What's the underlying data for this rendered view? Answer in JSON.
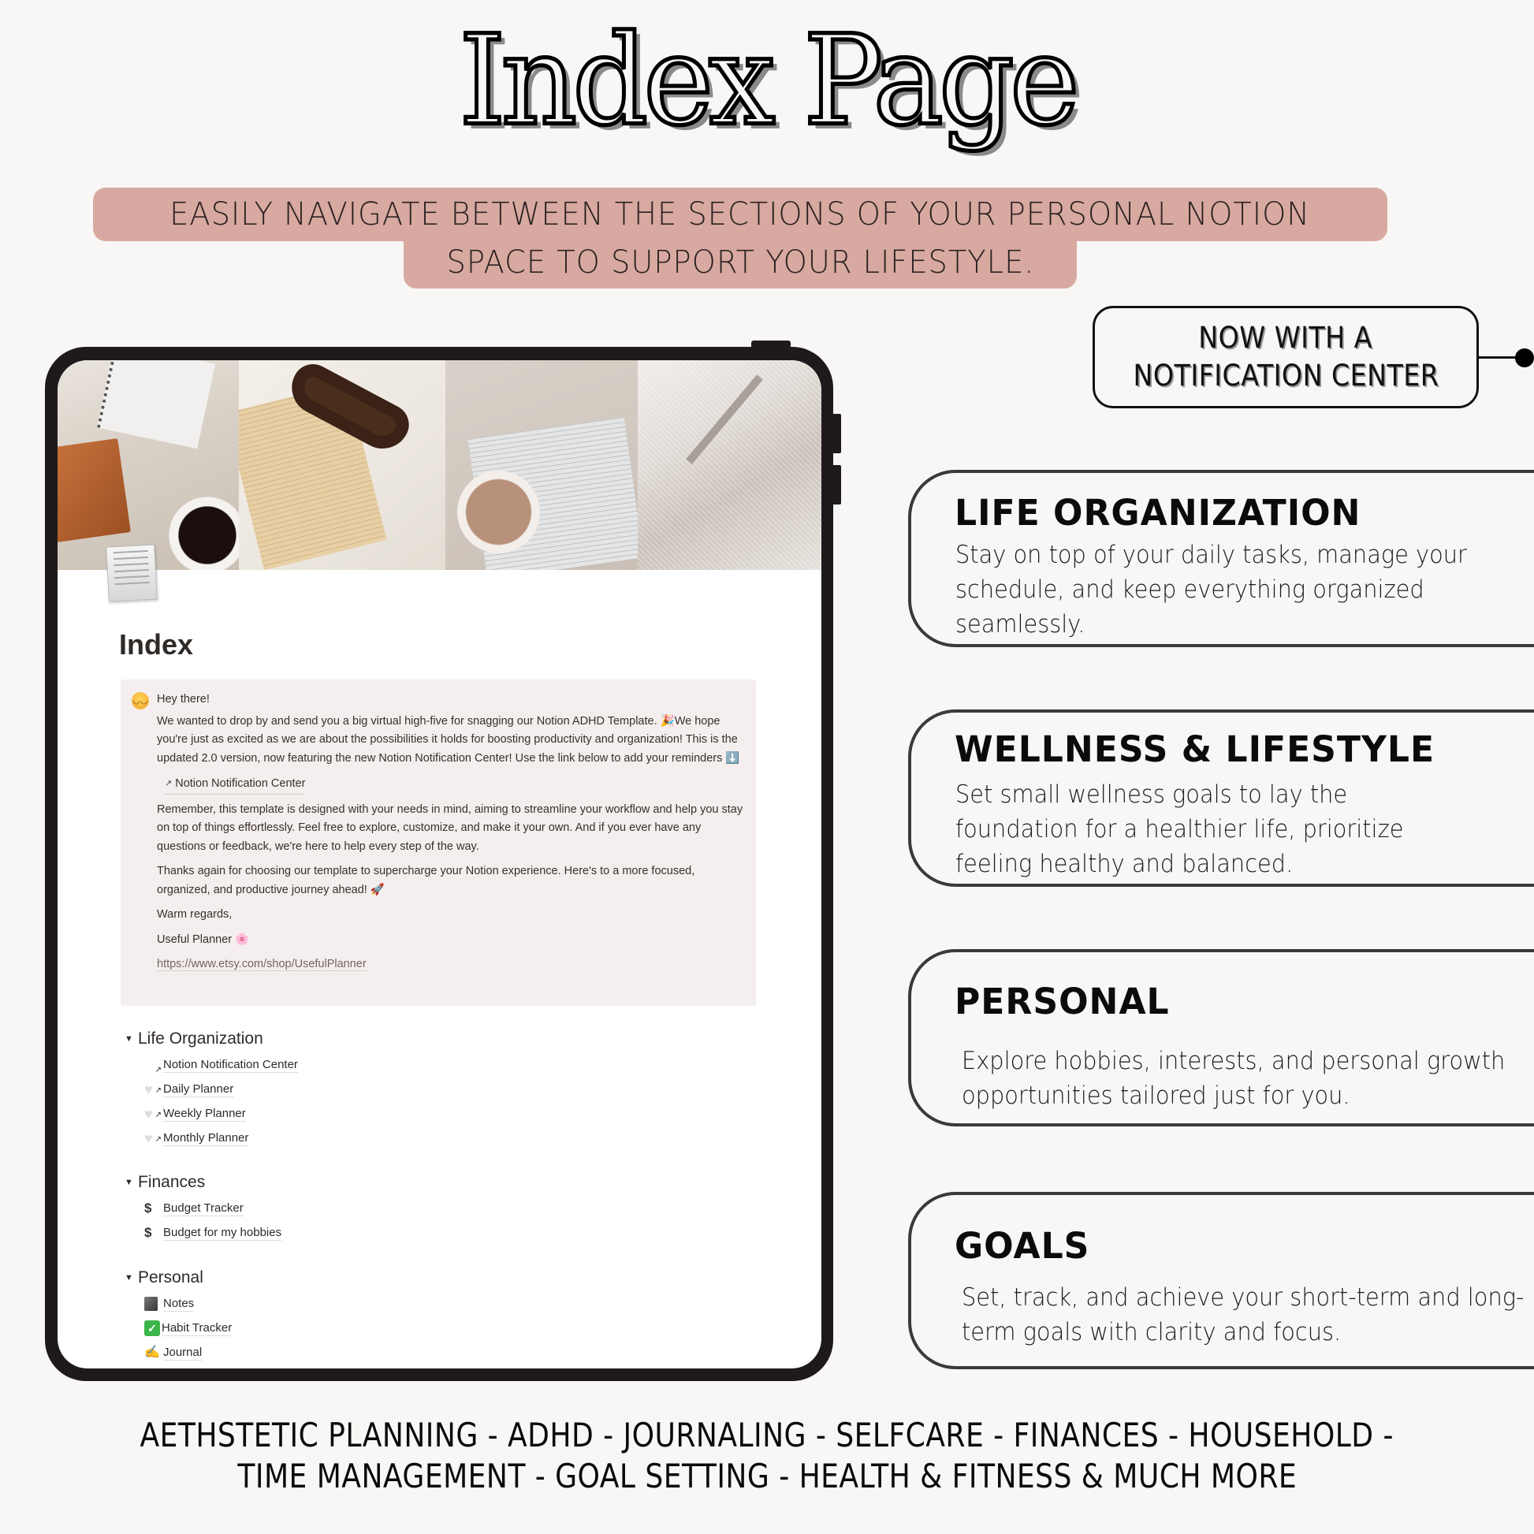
{
  "header": {
    "title": "Index Page",
    "banner_line1": "EASILY NAVIGATE BETWEEN THE SECTIONS OF YOUR  PERSONAL NOTION",
    "banner_line2": "SPACE TO SUPPORT YOUR LIFESTYLE."
  },
  "callout_badge": {
    "line1": "NOW WITH A",
    "line2": "NOTIFICATION CENTER"
  },
  "tablet": {
    "page_title": "Index",
    "page_icon": "document-icon",
    "cover_photos": [
      "notebook-coffee-photo",
      "book-sunglasses-photo",
      "coffee-book-earrings-photo",
      "fabric-leaf-shadow-photo"
    ],
    "callout": {
      "emoji": "smiling-face-icon",
      "greeting": "Hey there!",
      "paragraph1": "We wanted to drop by and send you a big virtual high-five for snagging our Notion ADHD Template. 🎉We hope you're just as excited as we are about the possibilities it holds for boosting productivity and organization! This is the updated 2.0 version, now featuring the new Notion Notification Center! Use the link below to add your reminders ⬇️",
      "link_label": "Notion Notification Center",
      "paragraph2": "Remember, this template is designed with your needs in mind, aiming to streamline your workflow and help you stay on top of things effortlessly. Feel free to explore, customize, and make it your own. And if you ever have any questions or feedback, we're here to help every step of the way.",
      "paragraph3": "Thanks again for choosing our template to supercharge your Notion experience. Here's to a more focused, organized, and productive journey ahead! 🚀",
      "signoff": "Warm regards,",
      "signature": "Useful Planner 🌸",
      "url": "https://www.etsy.com/shop/UsefulPlanner"
    },
    "sections": [
      {
        "title": "Life Organization",
        "items": [
          {
            "label": "Notion Notification Center",
            "icon": "bell-link-icon"
          },
          {
            "label": "Daily Planner",
            "icon": "white-heart-icon"
          },
          {
            "label": "Weekly Planner",
            "icon": "white-heart-icon"
          },
          {
            "label": "Monthly Planner",
            "icon": "white-heart-icon"
          }
        ]
      },
      {
        "title": "Finances",
        "items": [
          {
            "label": "Budget Tracker",
            "icon": "dollar-exchange-icon"
          },
          {
            "label": "Budget for my hobbies",
            "icon": "dollar-exchange-icon"
          }
        ]
      },
      {
        "title": "Personal",
        "items": [
          {
            "label": "Notes",
            "icon": "notebook-icon"
          },
          {
            "label": "Habit Tracker",
            "icon": "check-box-icon"
          },
          {
            "label": "Journal",
            "icon": "writing-hand-icon"
          }
        ]
      }
    ]
  },
  "features": [
    {
      "title": "LIFE ORGANIZATION",
      "description": "Stay on top of your daily tasks, manage your schedule, and keep everything organized seamlessly."
    },
    {
      "title": "WELLNESS & LIFESTYLE",
      "description": "Set small wellness goals to lay the foundation for a healthier life, prioritize feeling healthy and balanced."
    },
    {
      "title": "PERSONAL",
      "description": "Explore hobbies, interests, and personal growth opportunities tailored just for you."
    },
    {
      "title": "GOALS",
      "description": "Set, track, and achieve your short-term and long-term goals with clarity and focus."
    }
  ],
  "footer": {
    "line1": "AETHSTETIC PLANNING -  ADHD - JOURNALING - SELFCARE - FINANCES - HOUSEHOLD -",
    "line2": "TIME MANAGEMENT - GOAL SETTING - HEALTH & FITNESS & MUCH MORE"
  },
  "colors": {
    "background": "#f8f7f5",
    "banner": "#d8a9a0",
    "tablet_frame": "#1e1a1b",
    "callout_bg": "#f4eeee",
    "card_border": "#3c3a39"
  }
}
